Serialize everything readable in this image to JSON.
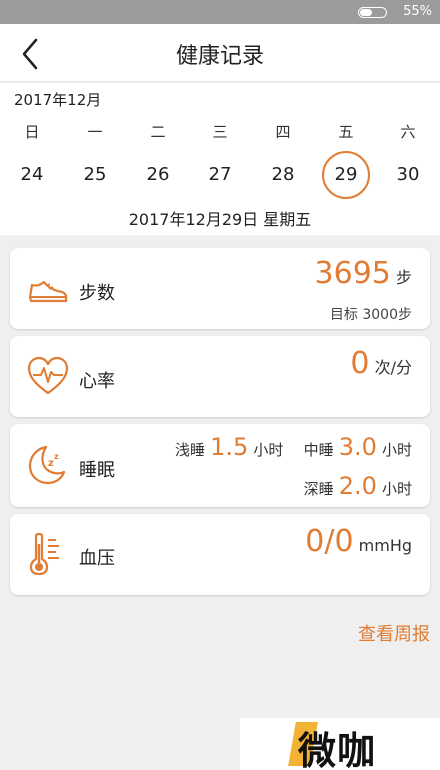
{
  "status_bar": {
    "battery_pct": "55%"
  },
  "nav": {
    "title": "健康记录"
  },
  "calendar": {
    "month": "2017年12月",
    "weekdays": [
      "日",
      "一",
      "二",
      "三",
      "四",
      "五",
      "六"
    ],
    "days": [
      "24",
      "25",
      "26",
      "27",
      "28",
      "29",
      "30"
    ],
    "selected_day": "29",
    "full_date": "2017年12月29日 星期五"
  },
  "steps": {
    "label": "步数",
    "value": "3695",
    "unit": "步",
    "goal": "目标 3000步"
  },
  "heart_rate": {
    "label": "心率",
    "value": "0",
    "unit": "次/分"
  },
  "sleep": {
    "label": "睡眠",
    "light_label": "浅睡",
    "light_value": "1.5",
    "mid_label": "中睡",
    "mid_value": "3.0",
    "deep_label": "深睡",
    "deep_value": "2.0",
    "unit": "小时"
  },
  "blood_pressure": {
    "label": "血压",
    "value": "0/0",
    "unit": "mmHg"
  },
  "weekly_link": "查看周报",
  "watermark": "微咖",
  "colors": {
    "accent": "#e07c33",
    "background": "#efefef",
    "status_bar": "#9b9b9b"
  }
}
